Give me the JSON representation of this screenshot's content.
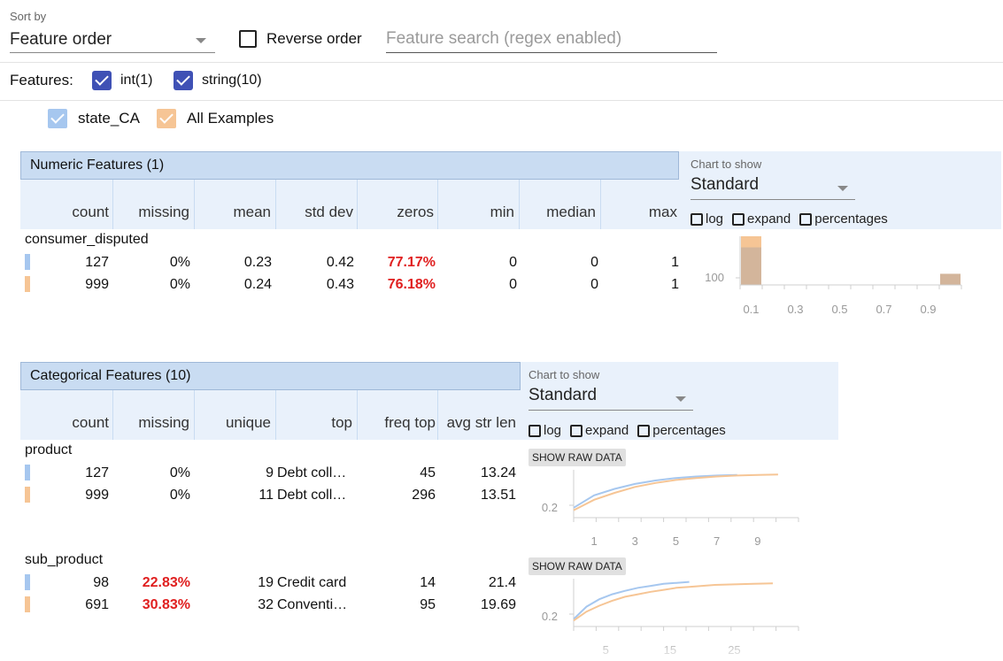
{
  "toolbar": {
    "sort_label": "Sort by",
    "sort_value": "Feature order",
    "reverse_label": "Reverse order",
    "search_placeholder": "Feature search (regex enabled)"
  },
  "features_filter": {
    "label": "Features:",
    "items": [
      {
        "label": "int(1)",
        "checked": true
      },
      {
        "label": "string(10)",
        "checked": true
      }
    ]
  },
  "datasets": [
    {
      "label": "state_CA",
      "color": "#a6c7ef"
    },
    {
      "label": "All Examples",
      "color": "#f6c595"
    }
  ],
  "numeric": {
    "title": "Numeric Features (1)",
    "columns": [
      "count",
      "missing",
      "mean",
      "std dev",
      "zeros",
      "min",
      "median",
      "max"
    ],
    "chart_panel": {
      "label": "Chart to show",
      "value": "Standard",
      "options": [
        "log",
        "expand",
        "percentages"
      ]
    },
    "features": [
      {
        "name": "consumer_disputed",
        "rows": [
          {
            "count": "127",
            "missing": "0%",
            "mean": "0.23",
            "std_dev": "0.42",
            "zeros": "77.17%",
            "min": "0",
            "median": "0",
            "max": "1"
          },
          {
            "count": "999",
            "missing": "0%",
            "mean": "0.24",
            "std_dev": "0.43",
            "zeros": "76.18%",
            "min": "0",
            "median": "0",
            "max": "1"
          }
        ]
      }
    ]
  },
  "categorical": {
    "title": "Categorical Features (10)",
    "columns": [
      "count",
      "missing",
      "unique",
      "top",
      "freq top",
      "avg str len"
    ],
    "chart_panel": {
      "label": "Chart to show",
      "value": "Standard",
      "options": [
        "log",
        "expand",
        "percentages"
      ]
    },
    "raw_data_label": "SHOW RAW DATA",
    "features": [
      {
        "name": "product",
        "rows": [
          {
            "count": "127",
            "missing": "0%",
            "unique": "9",
            "top": "Debt coll…",
            "freq_top": "45",
            "avg_str_len": "13.24"
          },
          {
            "count": "999",
            "missing": "0%",
            "unique": "11",
            "top": "Debt coll…",
            "freq_top": "296",
            "avg_str_len": "13.51"
          }
        ]
      },
      {
        "name": "sub_product",
        "rows": [
          {
            "count": "98",
            "missing": "22.83%",
            "unique": "19",
            "top": "Credit card",
            "freq_top": "14",
            "avg_str_len": "21.4"
          },
          {
            "count": "691",
            "missing": "30.83%",
            "unique": "32",
            "top": "Conventi…",
            "freq_top": "95",
            "avg_str_len": "19.69"
          }
        ]
      }
    ]
  },
  "chart_data": [
    {
      "type": "bar",
      "feature": "consumer_disputed",
      "x_ticks": [
        "0.1",
        "0.3",
        "0.5",
        "0.7",
        "0.9"
      ],
      "y_ticks": [
        "100"
      ],
      "series": [
        {
          "values": [
            127,
            0,
            0,
            0,
            0,
            0,
            0,
            0,
            0,
            29
          ],
          "color": "#f6c595"
        },
        {
          "values": [
            98,
            0,
            0,
            0,
            0,
            0,
            0,
            0,
            0,
            29
          ],
          "color": "#a6c7ef"
        }
      ],
      "bin_range": [
        0,
        1
      ]
    },
    {
      "type": "line",
      "feature": "product",
      "x_ticks": [
        "1",
        "3",
        "5",
        "7",
        "9"
      ],
      "y_ticks": [
        "0.2"
      ],
      "series": [
        {
          "color": "#a6c7ef",
          "x": [
            0,
            1,
            2,
            3,
            4,
            5,
            6,
            7,
            8
          ],
          "y": [
            0.2,
            0.45,
            0.58,
            0.68,
            0.75,
            0.8,
            0.83,
            0.85,
            0.86
          ]
        },
        {
          "color": "#f6c595",
          "x": [
            0,
            1,
            2,
            3,
            4,
            5,
            6,
            7,
            8,
            9,
            10
          ],
          "y": [
            0.15,
            0.36,
            0.5,
            0.62,
            0.7,
            0.76,
            0.8,
            0.83,
            0.85,
            0.86,
            0.87
          ]
        }
      ]
    },
    {
      "type": "line",
      "feature": "sub_product",
      "x_ticks": [
        "5",
        "15",
        "25"
      ],
      "y_ticks": [
        "0.2"
      ],
      "series": [
        {
          "color": "#a6c7ef",
          "x": [
            0,
            2,
            4,
            6,
            8,
            10,
            12,
            14,
            16,
            18
          ],
          "y": [
            0.15,
            0.4,
            0.55,
            0.65,
            0.72,
            0.78,
            0.82,
            0.86,
            0.88,
            0.9
          ]
        },
        {
          "color": "#f6c595",
          "x": [
            0,
            2,
            4,
            6,
            8,
            10,
            12,
            14,
            16,
            18,
            20,
            22,
            25,
            28,
            31
          ],
          "y": [
            0.12,
            0.3,
            0.42,
            0.52,
            0.6,
            0.65,
            0.7,
            0.74,
            0.78,
            0.8,
            0.82,
            0.84,
            0.85,
            0.86,
            0.87
          ]
        }
      ]
    }
  ]
}
